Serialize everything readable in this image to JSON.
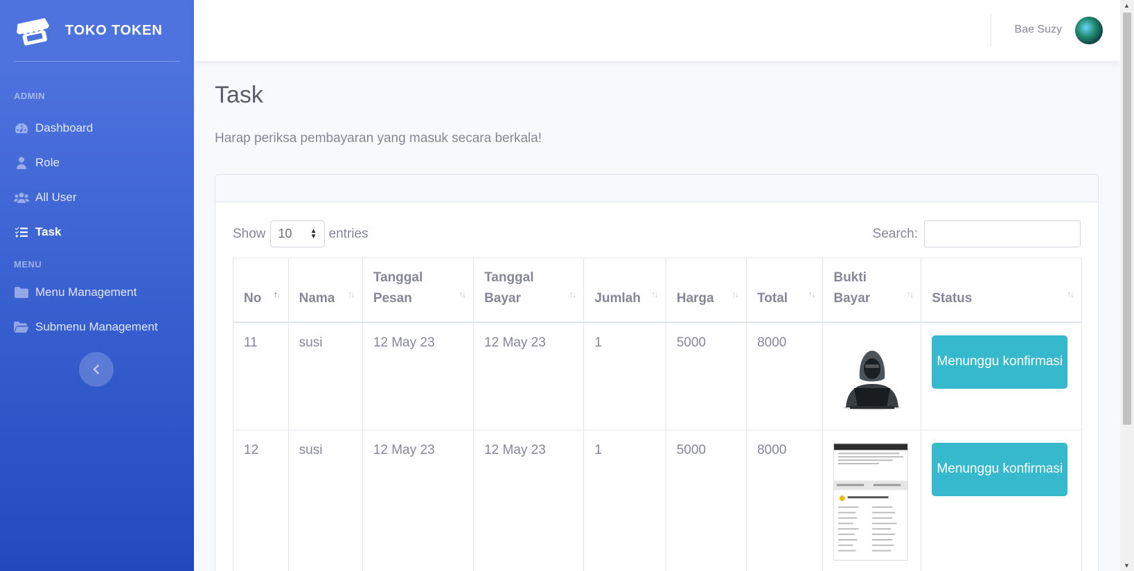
{
  "brand": {
    "name": "TOKO TOKEN"
  },
  "sidebar": {
    "heading_admin": "ADMIN",
    "heading_menu": "MENU",
    "admin_items": [
      {
        "label": "Dashboard",
        "icon": "tachometer-icon"
      },
      {
        "label": "Role",
        "icon": "user-tie-icon"
      },
      {
        "label": "All User",
        "icon": "users-icon"
      },
      {
        "label": "Task",
        "icon": "tasks-icon",
        "active": true
      }
    ],
    "menu_items": [
      {
        "label": "Menu Management",
        "icon": "folder-icon"
      },
      {
        "label": "Submenu Management",
        "icon": "folder-open-icon"
      }
    ],
    "toggle_icon": "chevron-left-icon"
  },
  "topbar": {
    "user_name": "Bae Suzy"
  },
  "main": {
    "title": "Task",
    "note": "Harap periksa pembayaran yang masuk secara berkala!"
  },
  "table": {
    "show_label": "Show",
    "length_value": "10",
    "entries_label": "entries",
    "search_label": "Search:",
    "columns": [
      {
        "line1": "No",
        "line2": ""
      },
      {
        "line1": "Nama",
        "line2": ""
      },
      {
        "line1": "Tanggal",
        "line2": "Pesan"
      },
      {
        "line1": "Tanggal",
        "line2": "Bayar"
      },
      {
        "line1": "Jumlah",
        "line2": ""
      },
      {
        "line1": "Harga",
        "line2": ""
      },
      {
        "line1": "Total",
        "line2": ""
      },
      {
        "line1": "Bukti",
        "line2": "Bayar"
      },
      {
        "line1": "Status",
        "line2": ""
      }
    ],
    "rows": [
      {
        "no": "11",
        "nama": "susi",
        "tanggal_pesan": "12 May 23",
        "tanggal_bayar": "12 May 23",
        "jumlah": "1",
        "harga": "5000",
        "total": "8000",
        "status": "Menunggu konfirmasi"
      },
      {
        "no": "12",
        "nama": "susi",
        "tanggal_pesan": "12 May 23",
        "tanggal_bayar": "12 May 23",
        "jumlah": "1",
        "harga": "5000",
        "total": "8000",
        "status": "Menunggu konfirmasi"
      }
    ]
  },
  "colors": {
    "sidebar_top": "#4e73df",
    "sidebar_bottom": "#224abe",
    "status_button": "#36b9cc"
  }
}
